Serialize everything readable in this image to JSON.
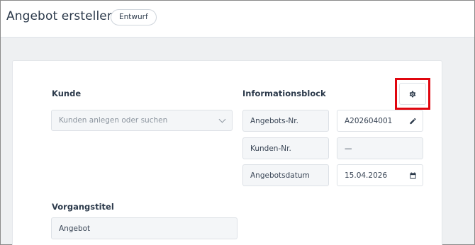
{
  "header": {
    "title": "Angebot erstellen",
    "status_badge": "Entwurf"
  },
  "customer": {
    "label": "Kunde",
    "search_placeholder": "Kunden anlegen oder suchen"
  },
  "info_block": {
    "label": "Informationsblock",
    "rows": [
      {
        "label": "Angebots-Nr.",
        "value": "A202604001",
        "icon": "pencil-icon"
      },
      {
        "label": "Kunden-Nr.",
        "value": "—"
      },
      {
        "label": "Angebotsdatum",
        "value": "15.04.2026",
        "icon": "calendar-icon"
      }
    ],
    "settings_icon": "gear-icon"
  },
  "process": {
    "label": "Vorgangstitel",
    "value": "Angebot"
  },
  "colors": {
    "highlight": "#e0060f",
    "text": "#2c3a4b",
    "field_bg": "#f4f6f8"
  }
}
